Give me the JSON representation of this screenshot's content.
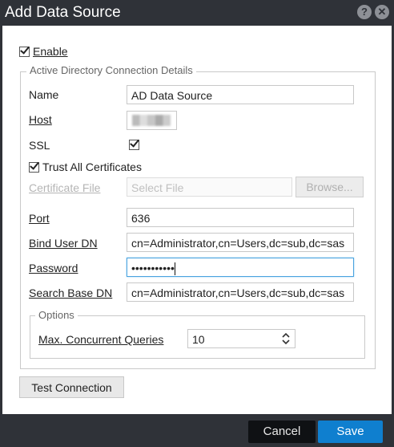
{
  "window": {
    "title": "Add Data Source"
  },
  "enable": {
    "label": "Enable",
    "checked": true
  },
  "connection": {
    "legend": "Active Directory Connection Details",
    "name": {
      "label": "Name",
      "value": "AD Data Source"
    },
    "host": {
      "label": "Host",
      "value": ""
    },
    "ssl": {
      "label": "SSL",
      "checked": true
    },
    "trust": {
      "label": "Trust All Certificates",
      "checked": true
    },
    "certificate": {
      "label": "Certificate File",
      "placeholder": "Select File",
      "browse_label": "Browse..."
    },
    "port": {
      "label": "Port",
      "value": "636"
    },
    "bind_user": {
      "label": "Bind User DN",
      "value": "cn=Administrator,cn=Users,dc=sub,dc=sas"
    },
    "password": {
      "label": "Password",
      "value": "•••••••••••"
    },
    "search_base": {
      "label": "Search Base DN",
      "value": "cn=Administrator,cn=Users,dc=sub,dc=sas"
    }
  },
  "options": {
    "legend": "Options",
    "max_queries": {
      "label": "Max. Concurrent Queries",
      "value": "10"
    }
  },
  "test_connection_label": "Test Connection",
  "footer": {
    "cancel_label": "Cancel",
    "save_label": "Save"
  },
  "icons": {
    "help": "help-icon",
    "close": "close-icon"
  },
  "colors": {
    "titlebar": "#2f3238",
    "save": "#0f7fcf",
    "cancel": "#0f1114",
    "focus": "#4aa3df"
  }
}
